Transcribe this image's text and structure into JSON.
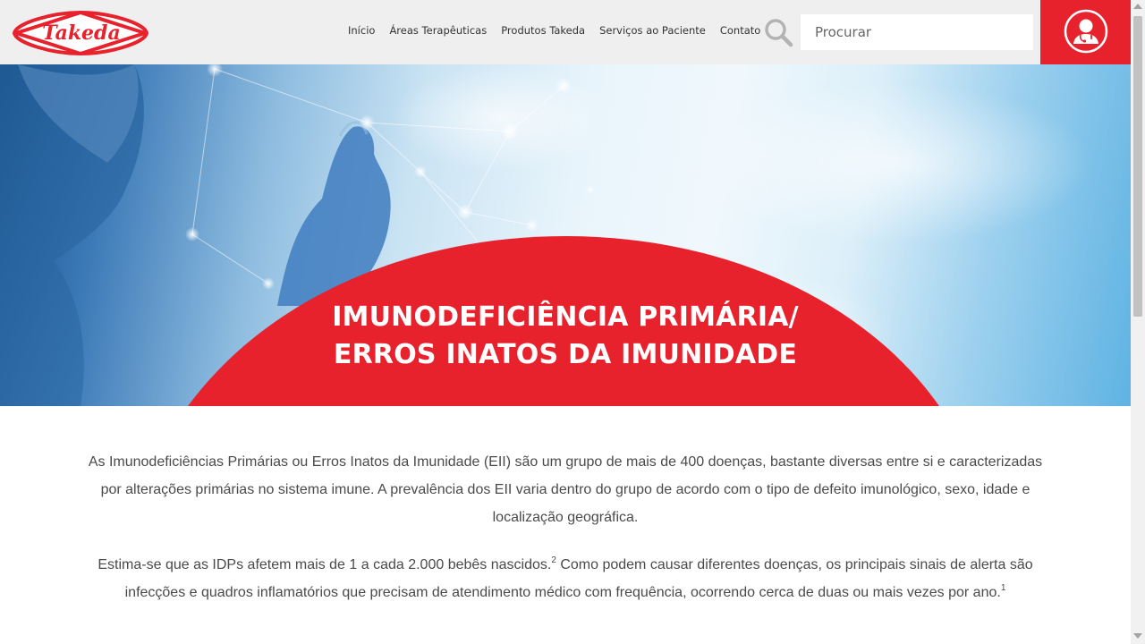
{
  "brand": {
    "logo_text": "Takeda",
    "accent_color": "#e8222d"
  },
  "nav": {
    "items": [
      {
        "label": "Início"
      },
      {
        "label": "Áreas Terapêuticas"
      },
      {
        "label": "Produtos Takeda"
      },
      {
        "label": "Serviços ao Paciente"
      },
      {
        "label": "Contato"
      }
    ]
  },
  "search": {
    "placeholder": "Procurar",
    "icon": "search-icon"
  },
  "account": {
    "icon": "doctor-user-icon"
  },
  "hero": {
    "title_line1": "IMUNODEFICIÊNCIA PRIMÁRIA/",
    "title_line2": "ERROS INATOS DA IMUNIDADE"
  },
  "content": {
    "paragraph1": "As Imunodeficiências Primárias ou Erros Inatos da Imunidade (EII) são um grupo de mais de 400 doenças, bastante diversas entre si e caracterizadas por alterações primárias no sistema imune. A prevalência dos EII varia dentro do grupo de acordo com o tipo de defeito imunológico, sexo, idade e localização geográfica.",
    "paragraph2_part1": "Estima-se que as IDPs afetem mais de 1 a cada 2.000 bebês nascidos.",
    "paragraph2_ref1": "2",
    "paragraph2_part2": " Como podem causar diferentes doenças, os principais sinais de alerta são infecções e quadros inflamatórios que precisam de atendimento médico com frequência, ocorrendo cerca de duas ou mais vezes por ano.",
    "paragraph2_ref2": "1"
  }
}
